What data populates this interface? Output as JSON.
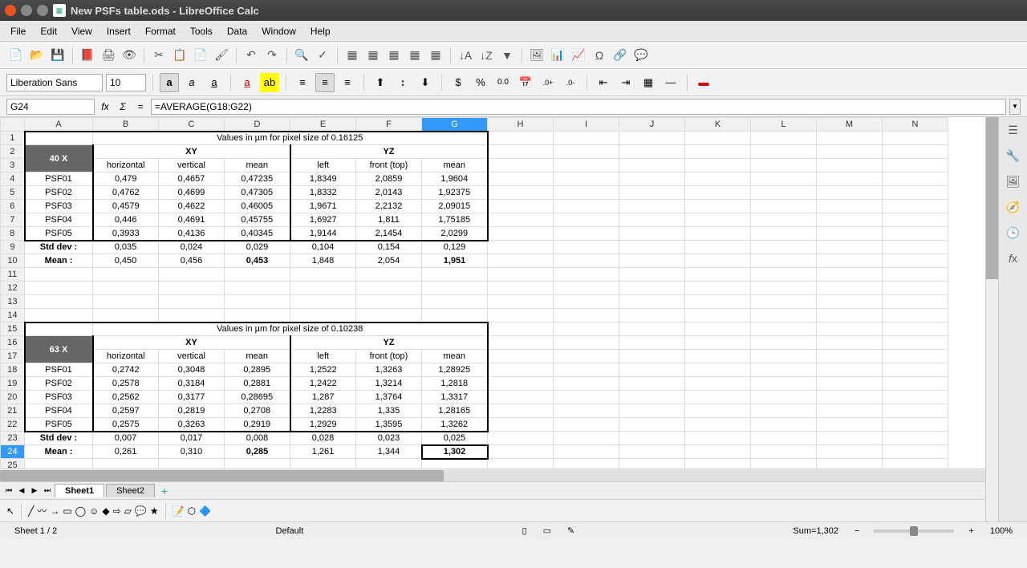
{
  "window": {
    "title": "New PSFs table.ods - LibreOffice Calc"
  },
  "menu": [
    "File",
    "Edit",
    "View",
    "Insert",
    "Format",
    "Tools",
    "Data",
    "Window",
    "Help"
  ],
  "font": {
    "name": "Liberation Sans",
    "size": "10"
  },
  "namebox": "G24",
  "formula": "=AVERAGE(G18:G22)",
  "columns": [
    "A",
    "B",
    "C",
    "D",
    "E",
    "F",
    "G",
    "H",
    "I",
    "J",
    "K",
    "L",
    "M",
    "N"
  ],
  "sheet": {
    "r1": {
      "title1": "Values in µm for pixel size of 0.16125"
    },
    "r2": {
      "A": "40 X",
      "XY": "XY",
      "YZ": "YZ"
    },
    "r3": {
      "B": "horizontal",
      "C": "vertical",
      "D": "mean",
      "E": "left",
      "F": "front (top)",
      "G": "mean"
    },
    "r4": {
      "A": "PSF01",
      "B": "0,479",
      "C": "0,4657",
      "D": "0,47235",
      "E": "1,8349",
      "F": "2,0859",
      "G": "1,9604"
    },
    "r5": {
      "A": "PSF02",
      "B": "0,4762",
      "C": "0,4699",
      "D": "0,47305",
      "E": "1,8332",
      "F": "2,0143",
      "G": "1,92375"
    },
    "r6": {
      "A": "PSF03",
      "B": "0,4579",
      "C": "0,4622",
      "D": "0,46005",
      "E": "1,9671",
      "F": "2,2132",
      "G": "2,09015"
    },
    "r7": {
      "A": "PSF04",
      "B": "0,446",
      "C": "0,4691",
      "D": "0,45755",
      "E": "1,6927",
      "F": "1,811",
      "G": "1,75185"
    },
    "r8": {
      "A": "PSF05",
      "B": "0,3933",
      "C": "0,4136",
      "D": "0,40345",
      "E": "1,9144",
      "F": "2,1454",
      "G": "2,0299"
    },
    "r9": {
      "A": "Std dev :",
      "B": "0,035",
      "C": "0,024",
      "D": "0,029",
      "E": "0,104",
      "F": "0,154",
      "G": "0,129"
    },
    "r10": {
      "A": "Mean :",
      "B": "0,450",
      "C": "0,456",
      "D": "0,453",
      "E": "1,848",
      "F": "2,054",
      "G": "1,951"
    },
    "r15": {
      "title2": "Values in µm for pixel size of 0.10238"
    },
    "r16": {
      "A": "63 X",
      "XY": "XY",
      "YZ": "YZ"
    },
    "r17": {
      "B": "horizontal",
      "C": "vertical",
      "D": "mean",
      "E": "left",
      "F": "front (top)",
      "G": "mean"
    },
    "r18": {
      "A": "PSF01",
      "B": "0,2742",
      "C": "0,3048",
      "D": "0,2895",
      "E": "1,2522",
      "F": "1,3263",
      "G": "1,28925"
    },
    "r19": {
      "A": "PSF02",
      "B": "0,2578",
      "C": "0,3184",
      "D": "0,2881",
      "E": "1,2422",
      "F": "1,3214",
      "G": "1,2818"
    },
    "r20": {
      "A": "PSF03",
      "B": "0,2562",
      "C": "0,3177",
      "D": "0,28695",
      "E": "1,287",
      "F": "1,3764",
      "G": "1,3317"
    },
    "r21": {
      "A": "PSF04",
      "B": "0,2597",
      "C": "0,2819",
      "D": "0,2708",
      "E": "1,2283",
      "F": "1,335",
      "G": "1,28165"
    },
    "r22": {
      "A": "PSF05",
      "B": "0,2575",
      "C": "0,3263",
      "D": "0,2919",
      "E": "1,2929",
      "F": "1,3595",
      "G": "1,3262"
    },
    "r23": {
      "A": "Std dev :",
      "B": "0,007",
      "C": "0,017",
      "D": "0,008",
      "E": "0,028",
      "F": "0,023",
      "G": "0,025"
    },
    "r24": {
      "A": "Mean :",
      "B": "0,261",
      "C": "0,310",
      "D": "0,285",
      "E": "1,261",
      "F": "1,344",
      "G": "1,302"
    }
  },
  "tabs": [
    "Sheet1",
    "Sheet2"
  ],
  "status": {
    "sheet": "Sheet 1 / 2",
    "style": "Default",
    "sum": "Sum=1,302",
    "zoom": "100%"
  }
}
